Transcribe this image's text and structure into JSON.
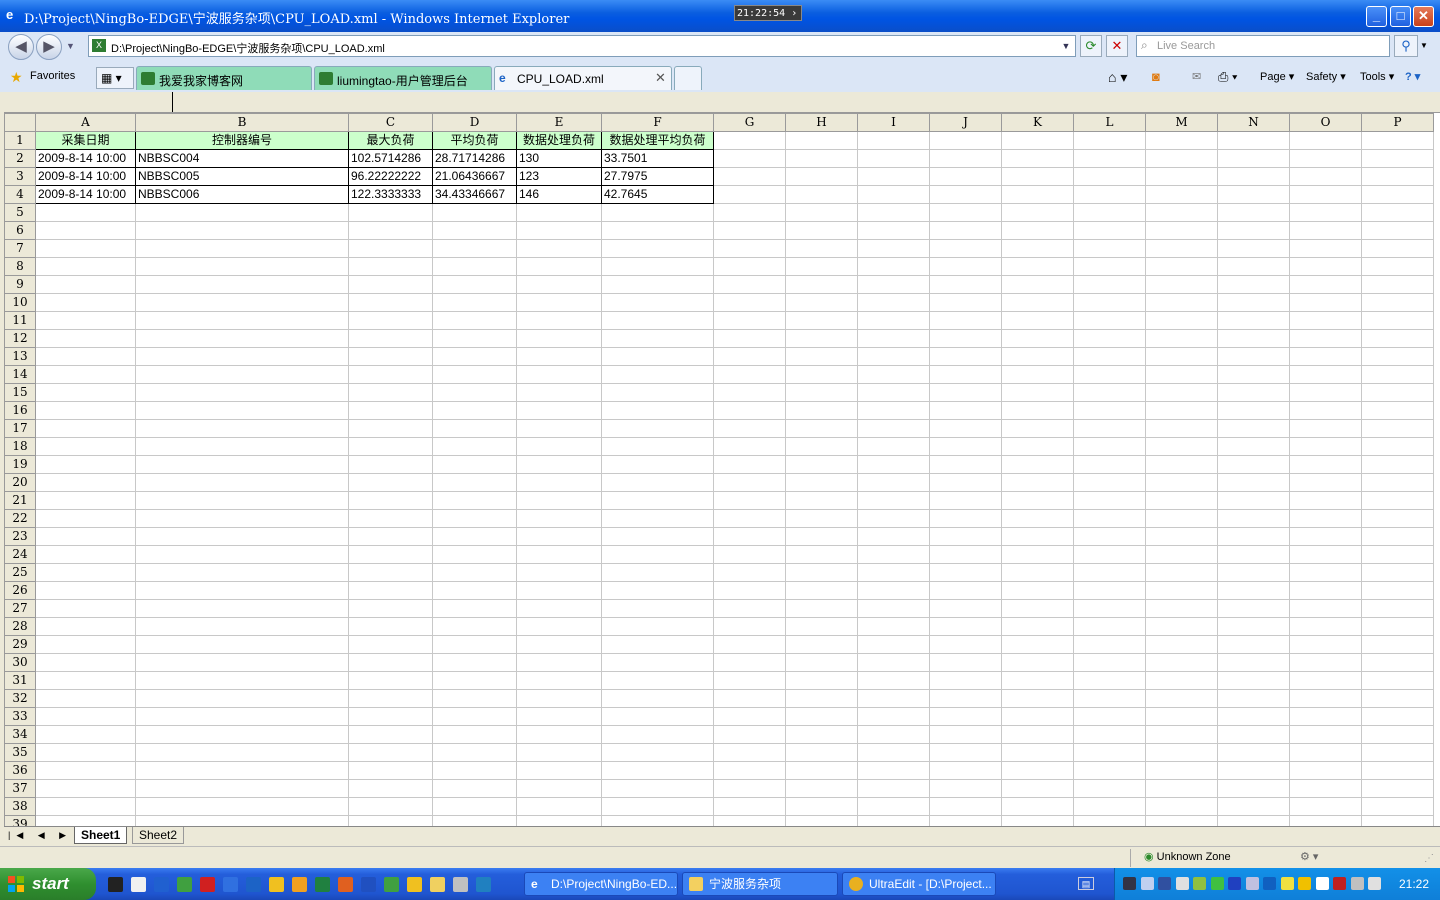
{
  "window": {
    "title": "D:\\Project\\NingBo-EDGE\\宁波服务杂项\\CPU_LOAD.xml - Windows Internet Explorer",
    "overlay_clock": "21:22:54"
  },
  "address_bar": {
    "url": "D:\\Project\\NingBo-EDGE\\宁波服务杂项\\CPU_LOAD.xml",
    "search_placeholder": "Live Search"
  },
  "favorites_label": "Favorites",
  "tabs": [
    {
      "label": "我爱我家博客网",
      "active": false
    },
    {
      "label": "liumingtao-用户管理后台",
      "active": false
    },
    {
      "label": "CPU_LOAD.xml",
      "active": true
    }
  ],
  "command_bar": {
    "page": "Page",
    "safety": "Safety",
    "tools": "Tools"
  },
  "spreadsheet": {
    "columns": [
      "A",
      "B",
      "C",
      "D",
      "E",
      "F",
      "G",
      "H",
      "I",
      "J",
      "K",
      "L",
      "M",
      "N",
      "O",
      "P"
    ],
    "headers": [
      "采集日期",
      "控制器编号",
      "最大负荷",
      "平均负荷",
      "数据处理负荷",
      "数据处理平均负荷"
    ],
    "rows": [
      [
        "2009-8-14 10:00",
        "NBBSC004",
        "102.5714286",
        "28.71714286",
        "130",
        "33.7501"
      ],
      [
        "2009-8-14 10:00",
        "NBBSC005",
        "96.22222222",
        "21.06436667",
        "123",
        "27.7975"
      ],
      [
        "2009-8-14 10:00",
        "NBBSC006",
        "122.3333333",
        "34.43346667",
        "146",
        "42.7645"
      ]
    ],
    "row_count": 39,
    "sheets": [
      "Sheet1",
      "Sheet2"
    ],
    "active_sheet": "Sheet1"
  },
  "status_bar": {
    "zone": "Unknown Zone"
  },
  "taskbar": {
    "start_label": "start",
    "tasks": [
      {
        "label": "D:\\Project\\NingBo-ED..."
      },
      {
        "label": "宁波服务杂项"
      },
      {
        "label": "UltraEdit - [D:\\Project..."
      }
    ],
    "clock": "21:22"
  },
  "colors": {
    "header_fill": "#ccffcc",
    "tab_green": "#8fdcb8",
    "titlebar_blue": "#0054e3",
    "taskbar_blue": "#245edb",
    "start_green": "#2f8f2f"
  }
}
